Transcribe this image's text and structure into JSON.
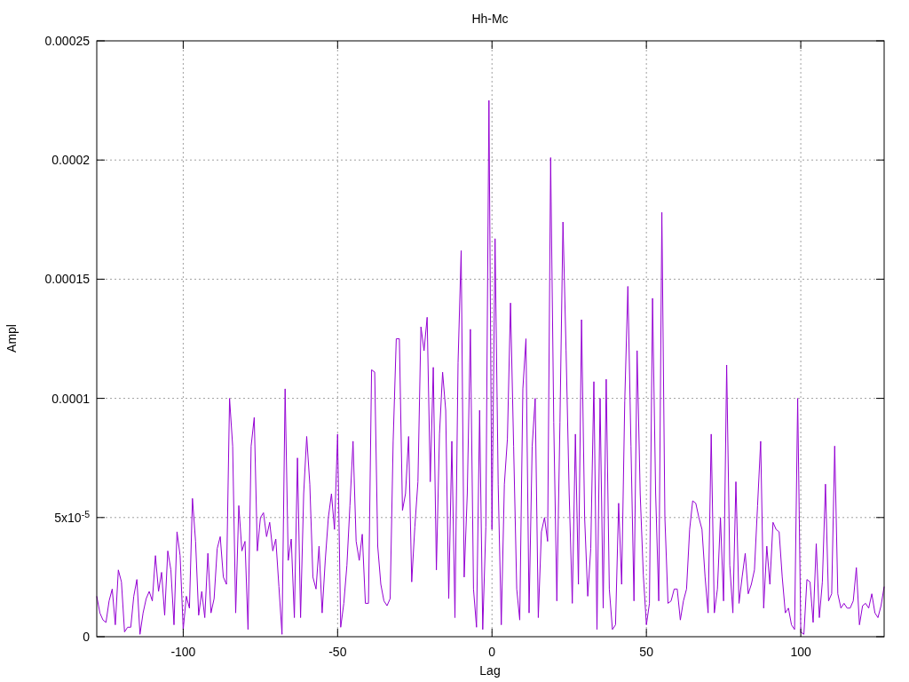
{
  "chart_data": {
    "type": "line",
    "title": "Hh-Mc",
    "xlabel": "Lag",
    "ylabel": "Ampl",
    "grid": true,
    "xlim": [
      -128,
      127
    ],
    "ylim": [
      0,
      0.00025
    ],
    "xticks": [
      -100,
      -50,
      0,
      50,
      100
    ],
    "yticks": [
      {
        "value": 0,
        "label": "0"
      },
      {
        "value": 5e-05,
        "label": "5x10$^{-5}$"
      },
      {
        "value": 0.0001,
        "label": "0.0001"
      },
      {
        "value": 0.00015,
        "label": "0.00015"
      },
      {
        "value": 0.0002,
        "label": "0.0002"
      },
      {
        "value": 0.00025,
        "label": "0.00025"
      }
    ],
    "x": [
      -128,
      -127,
      -126,
      -125,
      -124,
      -123,
      -122,
      -121,
      -120,
      -119,
      -118,
      -117,
      -116,
      -115,
      -114,
      -113,
      -112,
      -111,
      -110,
      -109,
      -108,
      -107,
      -106,
      -105,
      -104,
      -103,
      -102,
      -101,
      -100,
      -99,
      -98,
      -97,
      -96,
      -95,
      -94,
      -93,
      -92,
      -91,
      -90,
      -89,
      -88,
      -87,
      -86,
      -85,
      -84,
      -83,
      -82,
      -81,
      -80,
      -79,
      -78,
      -77,
      -76,
      -75,
      -74,
      -73,
      -72,
      -71,
      -70,
      -69,
      -68,
      -67,
      -66,
      -65,
      -64,
      -63,
      -62,
      -61,
      -60,
      -59,
      -58,
      -57,
      -56,
      -55,
      -54,
      -53,
      -52,
      -51,
      -50,
      -49,
      -48,
      -47,
      -46,
      -45,
      -44,
      -43,
      -42,
      -41,
      -40,
      -39,
      -38,
      -37,
      -36,
      -35,
      -34,
      -33,
      -32,
      -31,
      -30,
      -29,
      -28,
      -27,
      -26,
      -25,
      -24,
      -23,
      -22,
      -21,
      -20,
      -19,
      -18,
      -17,
      -16,
      -15,
      -14,
      -13,
      -12,
      -11,
      -10,
      -9,
      -8,
      -7,
      -6,
      -5,
      -4,
      -3,
      -2,
      -1,
      0,
      1,
      2,
      3,
      4,
      5,
      6,
      7,
      8,
      9,
      10,
      11,
      12,
      13,
      14,
      15,
      16,
      17,
      18,
      19,
      20,
      21,
      22,
      23,
      24,
      25,
      26,
      27,
      28,
      29,
      30,
      31,
      32,
      33,
      34,
      35,
      36,
      37,
      38,
      39,
      40,
      41,
      42,
      43,
      44,
      45,
      46,
      47,
      48,
      49,
      50,
      51,
      52,
      53,
      54,
      55,
      56,
      57,
      58,
      59,
      60,
      61,
      62,
      63,
      64,
      65,
      66,
      67,
      68,
      69,
      70,
      71,
      72,
      73,
      74,
      75,
      76,
      77,
      78,
      79,
      80,
      81,
      82,
      83,
      84,
      85,
      86,
      87,
      88,
      89,
      90,
      91,
      92,
      93,
      94,
      95,
      96,
      97,
      98,
      99,
      100,
      101,
      102,
      103,
      104,
      105,
      106,
      107,
      108,
      109,
      110,
      111,
      112,
      113,
      114,
      115,
      116,
      117,
      118,
      119,
      120,
      121,
      122,
      123,
      124,
      125,
      126,
      127
    ],
    "series": [
      {
        "color": "#9400d3",
        "values": [
          1.7e-05,
          1e-05,
          7e-06,
          6e-06,
          1.5e-05,
          2e-05,
          5e-06,
          2.8e-05,
          2.3e-05,
          2e-06,
          4e-06,
          4e-06,
          1.7e-05,
          2.4e-05,
          1e-06,
          1e-05,
          1.6e-05,
          1.9e-05,
          1.5e-05,
          3.4e-05,
          1.9e-05,
          2.7e-05,
          9e-06,
          3.6e-05,
          2.8e-05,
          5e-06,
          4.4e-05,
          3.4e-05,
          3e-06,
          1.7e-05,
          1.2e-05,
          5.8e-05,
          4e-05,
          9e-06,
          1.9e-05,
          8e-06,
          3.5e-05,
          1e-05,
          1.6e-05,
          3.7e-05,
          4.2e-05,
          2.5e-05,
          2.2e-05,
          0.0001,
          8e-05,
          1e-05,
          5.5e-05,
          3.6e-05,
          4e-05,
          3e-06,
          8e-05,
          9.2e-05,
          3.6e-05,
          5e-05,
          5.2e-05,
          4.2e-05,
          4.8e-05,
          3.6e-05,
          4.1e-05,
          2.1e-05,
          1e-06,
          0.000104,
          3.2e-05,
          4.1e-05,
          8e-06,
          7.5e-05,
          8e-06,
          6e-05,
          8.4e-05,
          6.4e-05,
          2.5e-05,
          2e-05,
          3.8e-05,
          1e-05,
          3.2e-05,
          5e-05,
          6e-05,
          4.5e-05,
          8.5e-05,
          4e-06,
          1.4e-05,
          3e-05,
          5.5e-05,
          8.2e-05,
          4e-05,
          3.2e-05,
          4.3e-05,
          1.4e-05,
          1.4e-05,
          0.000112,
          0.000111,
          3.8e-05,
          2.2e-05,
          1.5e-05,
          1.3e-05,
          1.6e-05,
          8.2e-05,
          0.000125,
          0.000125,
          5.3e-05,
          6e-05,
          8.4e-05,
          2.3e-05,
          4.6e-05,
          6.5e-05,
          0.00013,
          0.00012,
          0.000134,
          6.5e-05,
          0.000113,
          2.8e-05,
          8.5e-05,
          0.000111,
          9.5e-05,
          1.6e-05,
          8.2e-05,
          8e-06,
          0.000115,
          0.000162,
          2.5e-05,
          6e-05,
          0.000129,
          2e-05,
          4e-06,
          9.5e-05,
          3e-06,
          4.6e-05,
          0.000225,
          4.5e-05,
          0.000167,
          6.4e-05,
          5e-06,
          6.4e-05,
          8.3e-05,
          0.00014,
          8e-05,
          2e-05,
          7e-06,
          0.000104,
          0.000125,
          1e-05,
          8e-05,
          0.0001,
          8e-06,
          4.4e-05,
          5e-05,
          4e-05,
          0.000201,
          9e-05,
          1.5e-05,
          9e-05,
          0.000174,
          0.00012,
          6e-05,
          1.4e-05,
          8.5e-05,
          2.2e-05,
          0.000133,
          5e-05,
          1.7e-05,
          3.7e-05,
          0.000107,
          3e-06,
          0.0001,
          1.2e-05,
          0.000108,
          2e-05,
          3e-06,
          5e-06,
          5.6e-05,
          2.2e-05,
          9.9e-05,
          0.000147,
          8e-05,
          1.5e-05,
          0.00012,
          6e-05,
          2.6e-05,
          5e-06,
          1.4e-05,
          0.000142,
          6e-05,
          1.5e-05,
          0.000178,
          5e-05,
          1.4e-05,
          1.5e-05,
          2e-05,
          2e-05,
          7e-06,
          1.5e-05,
          2e-05,
          4.5e-05,
          5.7e-05,
          5.6e-05,
          5e-05,
          4.5e-05,
          2.5e-05,
          1e-05,
          8.5e-05,
          1e-05,
          2e-05,
          5e-05,
          1.5e-05,
          0.000114,
          3e-05,
          1e-05,
          6.5e-05,
          1.4e-05,
          2.5e-05,
          3.5e-05,
          1.8e-05,
          2.2e-05,
          2.8e-05,
          5.5e-05,
          8.2e-05,
          1.2e-05,
          3.8e-05,
          2.2e-05,
          4.8e-05,
          4.5e-05,
          4.4e-05,
          2.5e-05,
          1e-05,
          1.2e-05,
          5e-06,
          3e-06,
          0.0001,
          2e-06,
          1e-06,
          2.4e-05,
          2.3e-05,
          6e-06,
          3.9e-05,
          8e-06,
          2.3e-05,
          6.4e-05,
          1.5e-05,
          1.8e-05,
          8e-05,
          1.8e-05,
          1.2e-05,
          1.4e-05,
          1.2e-05,
          1.2e-05,
          1.5e-05,
          2.9e-05,
          5e-06,
          1.3e-05,
          1.4e-05,
          1.2e-05,
          1.8e-05,
          1e-05,
          8e-06,
          1.3e-05,
          2.1e-05
        ]
      }
    ]
  }
}
